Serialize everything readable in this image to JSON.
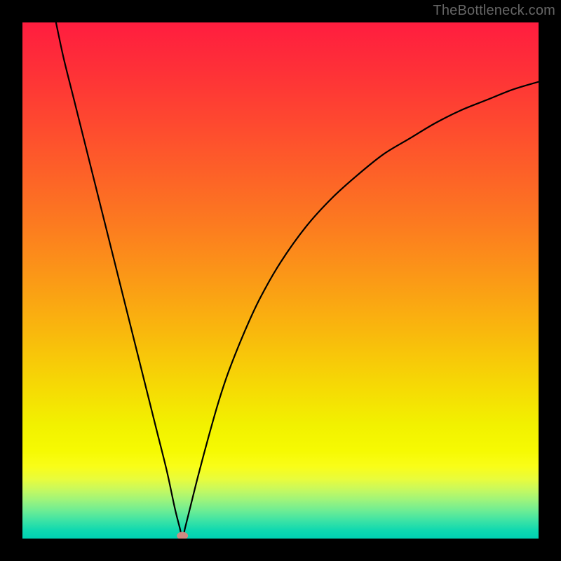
{
  "watermark": "TheBottleneck.com",
  "chart_data": {
    "type": "line",
    "title": "",
    "xlabel": "",
    "ylabel": "",
    "xlim": [
      0,
      1
    ],
    "ylim": [
      0,
      1
    ],
    "grid": false,
    "legend": false,
    "annotations": [],
    "minimum_marker": {
      "x": 0.31,
      "y": 0.0,
      "color": "#D08A82"
    },
    "series": [
      {
        "name": "curve",
        "points": [
          {
            "x": 0.065,
            "y": 1.0
          },
          {
            "x": 0.08,
            "y": 0.93
          },
          {
            "x": 0.1,
            "y": 0.85
          },
          {
            "x": 0.12,
            "y": 0.77
          },
          {
            "x": 0.14,
            "y": 0.69
          },
          {
            "x": 0.16,
            "y": 0.61
          },
          {
            "x": 0.18,
            "y": 0.53
          },
          {
            "x": 0.2,
            "y": 0.45
          },
          {
            "x": 0.22,
            "y": 0.37
          },
          {
            "x": 0.24,
            "y": 0.29
          },
          {
            "x": 0.26,
            "y": 0.21
          },
          {
            "x": 0.28,
            "y": 0.13
          },
          {
            "x": 0.295,
            "y": 0.06
          },
          {
            "x": 0.305,
            "y": 0.02
          },
          {
            "x": 0.31,
            "y": 0.0
          },
          {
            "x": 0.315,
            "y": 0.02
          },
          {
            "x": 0.325,
            "y": 0.06
          },
          {
            "x": 0.34,
            "y": 0.12
          },
          {
            "x": 0.36,
            "y": 0.195
          },
          {
            "x": 0.38,
            "y": 0.265
          },
          {
            "x": 0.4,
            "y": 0.325
          },
          {
            "x": 0.43,
            "y": 0.4
          },
          {
            "x": 0.46,
            "y": 0.465
          },
          {
            "x": 0.5,
            "y": 0.535
          },
          {
            "x": 0.55,
            "y": 0.605
          },
          {
            "x": 0.6,
            "y": 0.66
          },
          {
            "x": 0.65,
            "y": 0.705
          },
          {
            "x": 0.7,
            "y": 0.745
          },
          {
            "x": 0.75,
            "y": 0.775
          },
          {
            "x": 0.8,
            "y": 0.805
          },
          {
            "x": 0.85,
            "y": 0.83
          },
          {
            "x": 0.9,
            "y": 0.85
          },
          {
            "x": 0.95,
            "y": 0.87
          },
          {
            "x": 1.0,
            "y": 0.885
          }
        ]
      }
    ],
    "background_gradient": {
      "type": "vertical",
      "stops": [
        {
          "offset": 0.0,
          "color": "#FF1D3F"
        },
        {
          "offset": 0.1,
          "color": "#FE3237"
        },
        {
          "offset": 0.2,
          "color": "#FE4A2F"
        },
        {
          "offset": 0.3,
          "color": "#FD6327"
        },
        {
          "offset": 0.4,
          "color": "#FC7D1F"
        },
        {
          "offset": 0.5,
          "color": "#FB9A16"
        },
        {
          "offset": 0.6,
          "color": "#F9B80D"
        },
        {
          "offset": 0.7,
          "color": "#F6D805"
        },
        {
          "offset": 0.78,
          "color": "#F2F100"
        },
        {
          "offset": 0.83,
          "color": "#F6FA02"
        },
        {
          "offset": 0.86,
          "color": "#F9FD18"
        },
        {
          "offset": 0.885,
          "color": "#E8FC3D"
        },
        {
          "offset": 0.905,
          "color": "#C7F95E"
        },
        {
          "offset": 0.925,
          "color": "#9EF47B"
        },
        {
          "offset": 0.945,
          "color": "#6FED93"
        },
        {
          "offset": 0.965,
          "color": "#3DE3A5"
        },
        {
          "offset": 0.985,
          "color": "#0DD8B0"
        },
        {
          "offset": 1.0,
          "color": "#00D1B2"
        }
      ]
    }
  }
}
